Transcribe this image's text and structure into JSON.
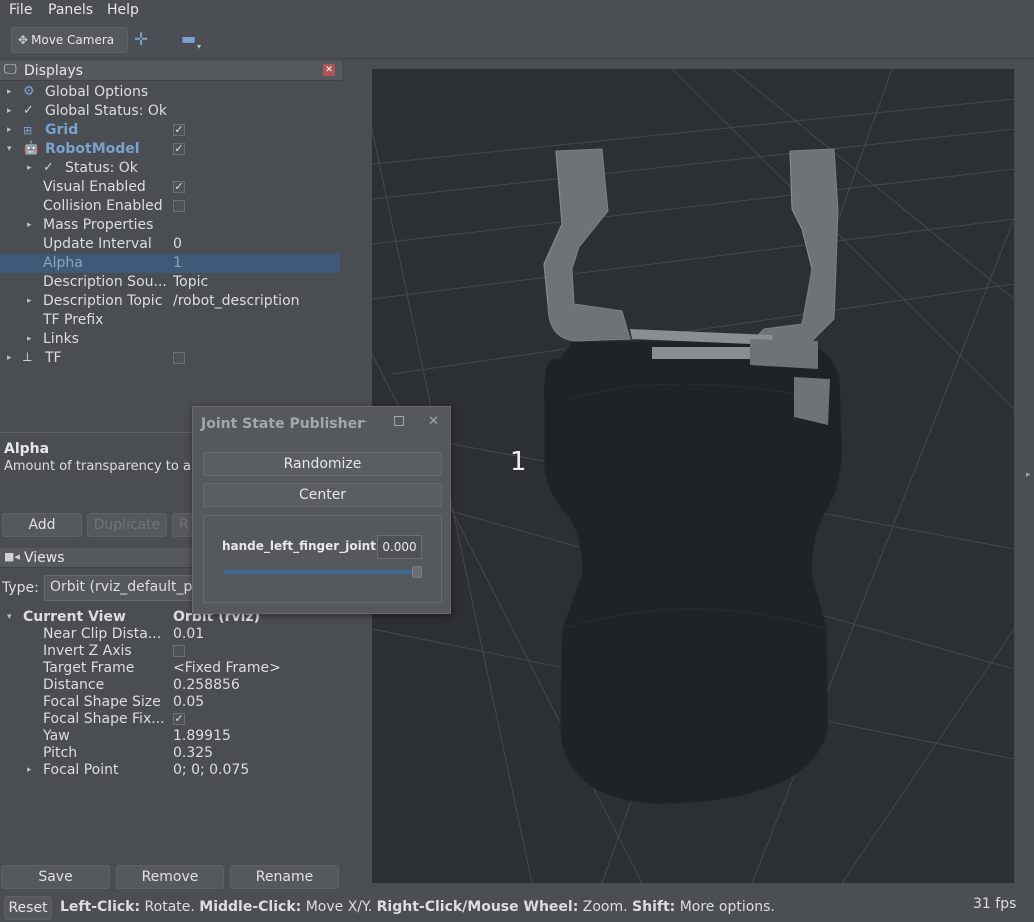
{
  "menu": [
    "File",
    "Panels",
    "Help"
  ],
  "toolbar": {
    "move_camera": "Move Camera"
  },
  "displays": {
    "title": "Displays",
    "items": [
      {
        "label": "Global Options",
        "value": ""
      },
      {
        "label": "Global Status: Ok",
        "value": ""
      },
      {
        "label": "Grid",
        "value": ""
      },
      {
        "label": "RobotModel",
        "value": ""
      },
      {
        "label": "Status: Ok",
        "value": ""
      },
      {
        "label": "Visual Enabled",
        "value": ""
      },
      {
        "label": "Collision Enabled",
        "value": ""
      },
      {
        "label": "Mass Properties",
        "value": ""
      },
      {
        "label": "Update Interval",
        "value": "0"
      },
      {
        "label": "Alpha",
        "value": "1"
      },
      {
        "label": "Description Sou...",
        "value": "Topic"
      },
      {
        "label": "Description Topic",
        "value": "/robot_description"
      },
      {
        "label": "TF Prefix",
        "value": ""
      },
      {
        "label": "Links",
        "value": ""
      },
      {
        "label": "TF",
        "value": ""
      }
    ],
    "checked": {
      "grid": true,
      "robotmodel": true,
      "visual": true,
      "collision": false,
      "tf": false
    }
  },
  "help": {
    "title": "Alpha",
    "text": "Amount of transparency to a"
  },
  "display_buttons": [
    "Add",
    "Duplicate",
    "R"
  ],
  "views": {
    "title": "Views",
    "type_label": "Type:",
    "type_value": "Orbit (rviz_default_pl",
    "current_view_label": "Current View",
    "current_view_value": "Orbit (rviz)",
    "props": [
      {
        "label": "Near Clip Dista...",
        "value": "0.01"
      },
      {
        "label": "Invert Z Axis",
        "value": ""
      },
      {
        "label": "Target Frame",
        "value": "<Fixed Frame>"
      },
      {
        "label": "Distance",
        "value": "0.258856"
      },
      {
        "label": "Focal Shape Size",
        "value": "0.05"
      },
      {
        "label": "Focal Shape Fix...",
        "value": ""
      },
      {
        "label": "Yaw",
        "value": "1.89915"
      },
      {
        "label": "Pitch",
        "value": "0.325"
      },
      {
        "label": "Focal Point",
        "value": "0; 0; 0.075"
      }
    ],
    "invert_z": false,
    "focal_fixed": true,
    "buttons": [
      "Save",
      "Remove",
      "Rename"
    ]
  },
  "viewport": {
    "overlay_number": "1"
  },
  "dialog": {
    "title": "Joint State Publisher",
    "randomize": "Randomize",
    "center": "Center",
    "joint_name": "hande_left_finger_joint",
    "joint_value": "0.000",
    "slider_fraction": 1.0
  },
  "status": {
    "reset": "Reset",
    "hint_parts": [
      {
        "b": "Left-Click:",
        "t": " Rotate. "
      },
      {
        "b": "Middle-Click:",
        "t": " Move X/Y. "
      },
      {
        "b": "Right-Click/Mouse Wheel:",
        "t": " Zoom. "
      },
      {
        "b": "Shift:",
        "t": " More options."
      }
    ],
    "fps": "31 fps"
  }
}
